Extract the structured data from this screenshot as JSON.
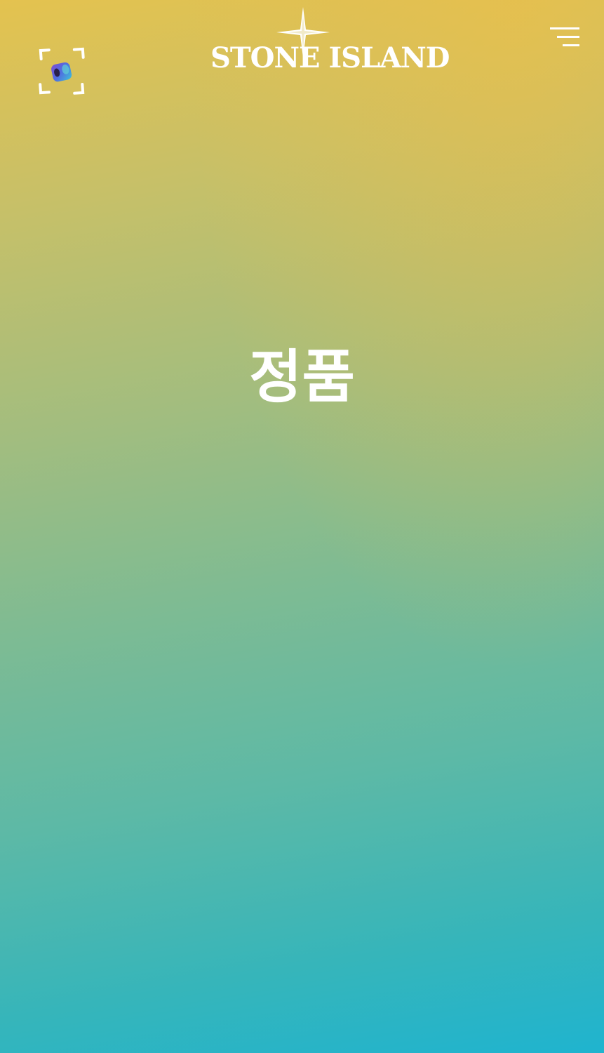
{
  "header": {
    "scan_icon": "ar-scan-icon",
    "logo_icon": "compass-star-icon",
    "logo_text": "STONE ISLAND",
    "menu_icon": "hamburger-menu-icon"
  },
  "main": {
    "title": "정품"
  },
  "colors": {
    "gradient_top": "#e4c24f",
    "gradient_middle": "#7ebb93",
    "gradient_bottom": "#1fb4cf",
    "foreground": "#ffffff"
  }
}
